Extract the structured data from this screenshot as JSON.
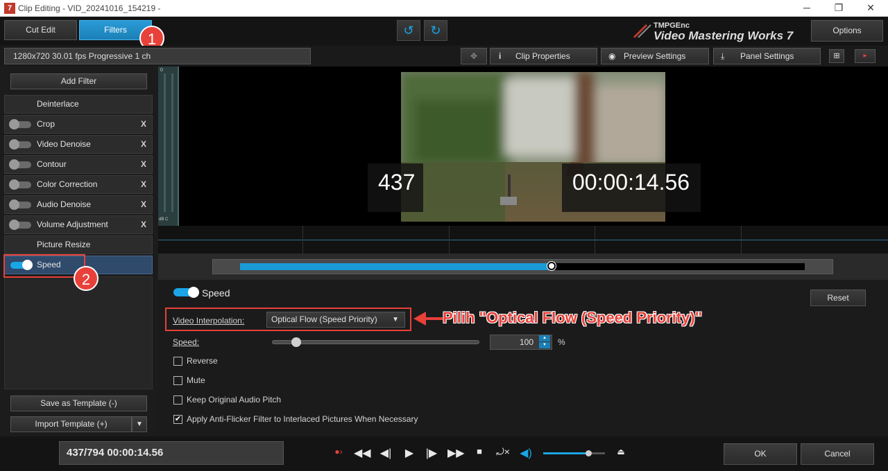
{
  "window": {
    "title": "Clip Editing - VID_20241016_154219 -",
    "minimize": "─",
    "maximize": "❐",
    "close": "✕"
  },
  "toolbar": {
    "tab_cut_edit": "Cut Edit",
    "tab_filters": "Filters",
    "undo_icon": "↺",
    "redo_icon": "↻",
    "logo_small": "TMPGEnc",
    "logo_big": "Video Mastering Works 7",
    "options": "Options"
  },
  "annotations": {
    "badge1": "1",
    "badge2": "2",
    "arrow_text": "Pilih \"Optical Flow (Speed Priority)\"",
    "accent": "#e8413a"
  },
  "infobar": {
    "video_info": "1280x720 30.01 fps Progressive  1 ch",
    "clip_properties": "Clip Properties",
    "preview_settings": "Preview Settings",
    "panel_settings": "Panel Settings"
  },
  "filters": {
    "add_filter": "Add Filter",
    "items": [
      {
        "label": "Deinterlace",
        "toggle": false,
        "removable": false,
        "selected": false
      },
      {
        "label": "Crop",
        "toggle": true,
        "on": false,
        "removable": true,
        "selected": false
      },
      {
        "label": "Video Denoise",
        "toggle": true,
        "on": false,
        "removable": true,
        "selected": false
      },
      {
        "label": "Contour",
        "toggle": true,
        "on": false,
        "removable": true,
        "selected": false
      },
      {
        "label": "Color Correction",
        "toggle": true,
        "on": false,
        "removable": true,
        "selected": false
      },
      {
        "label": "Audio Denoise",
        "toggle": true,
        "on": false,
        "removable": true,
        "selected": false
      },
      {
        "label": "Volume Adjustment",
        "toggle": true,
        "on": false,
        "removable": true,
        "selected": false
      },
      {
        "label": "Picture Resize",
        "toggle": false,
        "removable": false,
        "selected": false
      },
      {
        "label": "Speed",
        "toggle": true,
        "on": true,
        "removable": false,
        "selected": true
      }
    ],
    "remove_glyph": "X",
    "save_template": "Save as Template (-)",
    "import_template": "Import Template (+)",
    "import_arrow": "▼"
  },
  "preview": {
    "frame_number": "437",
    "timecode": "00:00:14.56",
    "vu_top": "0",
    "vu_bottom": "dB C"
  },
  "scrubber": {
    "position": 0.552
  },
  "speed_panel": {
    "title": "Speed",
    "enabled": true,
    "reset": "Reset",
    "interp_label": "Video Interpolation:",
    "interp_value": "Optical Flow (Speed Priority)",
    "interp_arrow": "▼",
    "speed_label": "Speed:",
    "speed_value": "100",
    "speed_unit": "%",
    "speed_slider_position": 0.114,
    "checks": [
      {
        "label": "Reverse",
        "checked": false
      },
      {
        "label": "Mute",
        "checked": false
      },
      {
        "label": "Keep Original Audio Pitch",
        "checked": false
      },
      {
        "label": "Apply Anti-Flicker Filter to Interlaced Pictures When Necessary",
        "checked": true
      }
    ]
  },
  "bottom": {
    "position": "437/794  00:00:14.56",
    "volume_level": 0.73,
    "ok": "OK",
    "cancel": "Cancel"
  },
  "colors": {
    "accent_blue": "#1aa5e6",
    "annotation_red": "#e8413a"
  }
}
